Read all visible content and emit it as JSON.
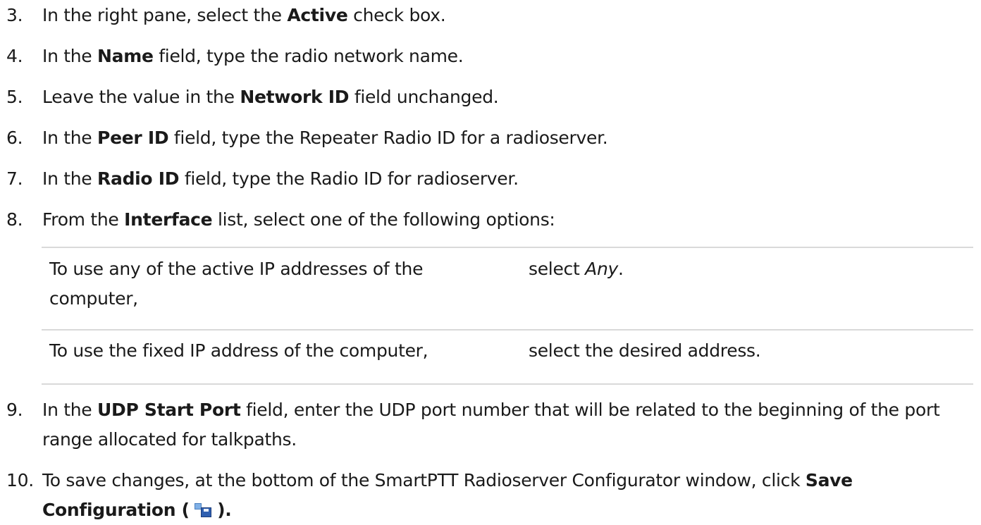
{
  "steps": [
    {
      "num": "3.",
      "pre": "In the right pane, select the ",
      "bold": "Active",
      "post": " check box."
    },
    {
      "num": "4.",
      "pre": "In the ",
      "bold": "Name",
      "post": " field, type the radio network name."
    },
    {
      "num": "5.",
      "pre": "Leave the value in the ",
      "bold": "Network ID",
      "post": " field unchanged."
    },
    {
      "num": "6.",
      "pre": "In the ",
      "bold": "Peer ID",
      "post": " field, type the Repeater Radio ID for a radioserver."
    },
    {
      "num": "7.",
      "pre": "In the ",
      "bold": "Radio ID",
      "post": " field, type the Radio ID for radioserver."
    },
    {
      "num": "8.",
      "pre": "From the ",
      "bold": "Interface",
      "post": " list, select one of the following options:"
    },
    {
      "num": "9.",
      "pre": "In the ",
      "bold": "UDP Start Port",
      "post": " field, enter the UDP port number that will be related to the beginning of the port range allocated for talkpaths."
    },
    {
      "num": "10.",
      "pre": "To save changes, at the bottom of the SmartPTT Radioserver Configurator window, click ",
      "bold": "Save Configuration (",
      "post_bold": ").",
      "icon": "save-configuration-icon"
    }
  ],
  "options": [
    {
      "condition": "To use any of the active IP addresses of the computer,",
      "action_pre": "select ",
      "action_italic": "Any",
      "action_post": "."
    },
    {
      "condition": "To use the fixed IP address of the computer,",
      "action_pre": "select the desired address.",
      "action_italic": "",
      "action_post": ""
    }
  ]
}
